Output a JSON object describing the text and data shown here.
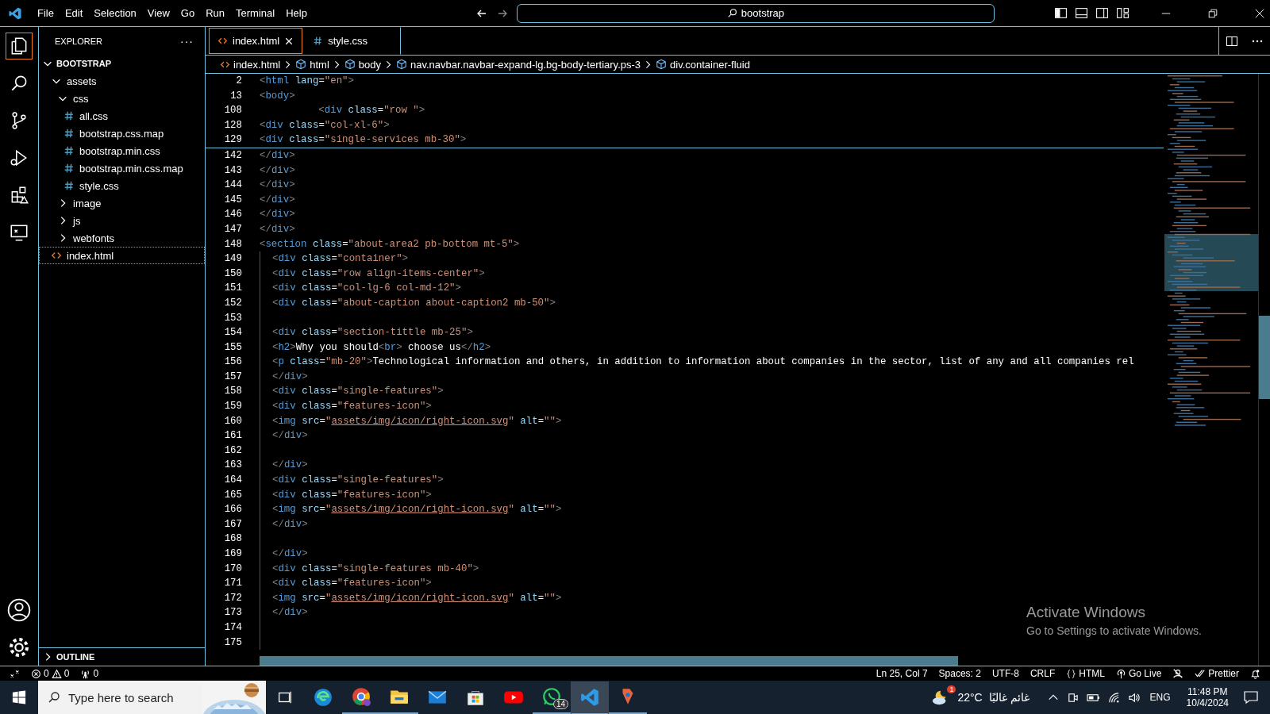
{
  "menu": [
    "File",
    "Edit",
    "Selection",
    "View",
    "Go",
    "Run",
    "Terminal",
    "Help"
  ],
  "search": {
    "value": "bootstrap"
  },
  "activity": [
    {
      "kind": "files",
      "selected": true
    },
    {
      "kind": "search",
      "selected": false
    },
    {
      "kind": "branch",
      "selected": false
    },
    {
      "kind": "run",
      "selected": false
    },
    {
      "kind": "extensions",
      "selected": false
    },
    {
      "kind": "remote",
      "selected": false
    }
  ],
  "explorer": {
    "title": "EXPLORER",
    "more": "···",
    "root": {
      "label": "BOOTSTRAP",
      "expanded": true
    },
    "tree": [
      {
        "label": "assets",
        "kind": "folder",
        "expanded": true,
        "selected": false,
        "children": [
          {
            "label": "css",
            "kind": "folder",
            "expanded": true,
            "selected": false,
            "children": [
              {
                "label": "all.css",
                "kind": "css",
                "selected": false
              },
              {
                "label": "bootstrap.css.map",
                "kind": "css",
                "selected": false
              },
              {
                "label": "bootstrap.min.css",
                "kind": "css",
                "selected": false
              },
              {
                "label": "bootstrap.min.css.map",
                "kind": "css",
                "selected": false
              },
              {
                "label": "style.css",
                "kind": "css",
                "selected": false
              }
            ]
          },
          {
            "label": "image",
            "kind": "folder",
            "expanded": false,
            "selected": false
          },
          {
            "label": "js",
            "kind": "folder",
            "expanded": false,
            "selected": false
          },
          {
            "label": "webfonts",
            "kind": "folder",
            "expanded": false,
            "selected": false
          }
        ]
      },
      {
        "label": "index.html",
        "kind": "html",
        "selected": true
      }
    ],
    "outline": {
      "label": "OUTLINE",
      "expanded": false
    }
  },
  "tabs": [
    {
      "label": "index.html",
      "kind": "html",
      "selected": true
    },
    {
      "label": "style.css",
      "kind": "css",
      "selected": false
    }
  ],
  "breadcrumbs": [
    {
      "label": "index.html",
      "kind": "html"
    },
    {
      "label": "html",
      "kind": "element"
    },
    {
      "label": "body",
      "kind": "element"
    },
    {
      "label": "nav.navbar.navbar-expand-lg.bg-body-tertiary.ps-3",
      "kind": "element"
    },
    {
      "label": "div.container-fluid",
      "kind": "element"
    }
  ],
  "sticky_lines": [
    {
      "num": "2",
      "guide": false,
      "text": "<html lang=\"en\">"
    },
    {
      "num": "13",
      "guide": false,
      "text": "<body>"
    },
    {
      "num": "108",
      "guide": false,
      "text": "          <div class=\"row \">"
    },
    {
      "num": "128",
      "guide": false,
      "text": "<div class=\"col-xl-6\">"
    },
    {
      "num": "129",
      "guide": false,
      "text": "<div class=\"single-services mb-30\">"
    }
  ],
  "lines": [
    {
      "num": "142",
      "guide": false,
      "text": "</div>"
    },
    {
      "num": "143",
      "guide": false,
      "text": "</div>"
    },
    {
      "num": "144",
      "guide": false,
      "text": "</div>"
    },
    {
      "num": "145",
      "guide": false,
      "text": "</div>"
    },
    {
      "num": "146",
      "guide": false,
      "text": "</div>"
    },
    {
      "num": "147",
      "guide": false,
      "text": "</div>"
    },
    {
      "num": "148",
      "guide": false,
      "text": "<section class=\"about-area2 pb-bottom mt-5\">"
    },
    {
      "num": "149",
      "guide": true,
      "text": "<div class=\"container\">"
    },
    {
      "num": "150",
      "guide": true,
      "text": "<div class=\"row align-items-center\">"
    },
    {
      "num": "151",
      "guide": true,
      "text": "<div class=\"col-lg-6 col-md-12\">"
    },
    {
      "num": "152",
      "guide": true,
      "text": "<div class=\"about-caption about-caption2 mb-50\">"
    },
    {
      "num": "153",
      "guide": true
    },
    {
      "num": "154",
      "guide": true,
      "text": "<div class=\"section-tittle mb-25\">"
    },
    {
      "num": "155",
      "guide": true,
      "text": "<h2>Why you should<br> choose us</h2>"
    },
    {
      "num": "156",
      "guide": true,
      "text": "<p class=\"mb-20\">Technological information and others, in addition to information about companies in the sector, list of any and all companies rel"
    },
    {
      "num": "157",
      "guide": true,
      "text": "</div>"
    },
    {
      "num": "158",
      "guide": true,
      "text": "<div class=\"single-features\">"
    },
    {
      "num": "159",
      "guide": true,
      "text": "<div class=\"features-icon\">"
    },
    {
      "num": "160",
      "guide": true,
      "text": "<img src=\"assets/img/icon/right-icon.svg\" alt=\"\">"
    },
    {
      "num": "161",
      "guide": true,
      "text": "</div>"
    },
    {
      "num": "162",
      "guide": true
    },
    {
      "num": "163",
      "guide": true,
      "text": "</div>"
    },
    {
      "num": "164",
      "guide": true,
      "text": "<div class=\"single-features\">"
    },
    {
      "num": "165",
      "guide": true,
      "text": "<div class=\"features-icon\">"
    },
    {
      "num": "166",
      "guide": true,
      "text": "<img src=\"assets/img/icon/right-icon.svg\" alt=\"\">"
    },
    {
      "num": "167",
      "guide": true,
      "text": "</div>"
    },
    {
      "num": "168",
      "guide": true
    },
    {
      "num": "169",
      "guide": true,
      "text": "</div>"
    },
    {
      "num": "170",
      "guide": true,
      "text": "<div class=\"single-features mb-40\">"
    },
    {
      "num": "171",
      "guide": true,
      "text": "<div class=\"features-icon\">"
    },
    {
      "num": "172",
      "guide": true,
      "text": "<img src=\"assets/img/icon/right-icon.svg\" alt=\"\">"
    },
    {
      "num": "173",
      "guide": true,
      "text": "</div>"
    },
    {
      "num": "174",
      "guide": true
    },
    {
      "num": "175",
      "guide": true
    }
  ],
  "activation": {
    "title": "Activate Windows",
    "text": "Go to Settings to activate Windows."
  },
  "status_bar": {
    "errors": "0",
    "warnings": "0",
    "ports": "0",
    "right": [
      {
        "kind": "text",
        "text": "Ln 25, Col 7"
      },
      {
        "kind": "text",
        "text": "Spaces: 2"
      },
      {
        "kind": "text",
        "text": "UTF-8"
      },
      {
        "kind": "text",
        "text": "CRLF"
      },
      {
        "kind": "braces",
        "text": "HTML"
      },
      {
        "kind": "broadcast",
        "text": "Go Live"
      },
      {
        "kind": "person-off"
      },
      {
        "kind": "check-double",
        "text": "Prettier"
      },
      {
        "kind": "bell"
      }
    ]
  },
  "taskbar": {
    "search_placeholder": "Type here to search",
    "apps": [
      {
        "kind": "task-view",
        "active": false,
        "running": false
      },
      {
        "kind": "edge",
        "active": false,
        "running": false
      },
      {
        "kind": "chrome",
        "active": false,
        "running": true
      },
      {
        "kind": "explorer",
        "active": false,
        "running": true
      },
      {
        "kind": "mail",
        "active": false,
        "running": false
      },
      {
        "kind": "store",
        "active": false,
        "running": false
      },
      {
        "kind": "youtube",
        "active": false,
        "running": false
      },
      {
        "kind": "whatsapp",
        "active": false,
        "running": true,
        "badge": "14"
      },
      {
        "kind": "vscode",
        "active": true,
        "running": true
      },
      {
        "kind": "paint",
        "active": false,
        "running": true
      }
    ],
    "weather": {
      "temp": "22°C",
      "condition": "غائم غالبًا",
      "badge": "1"
    },
    "language": "ENG",
    "time": "11:48 PM",
    "date": "10/4/2024"
  }
}
